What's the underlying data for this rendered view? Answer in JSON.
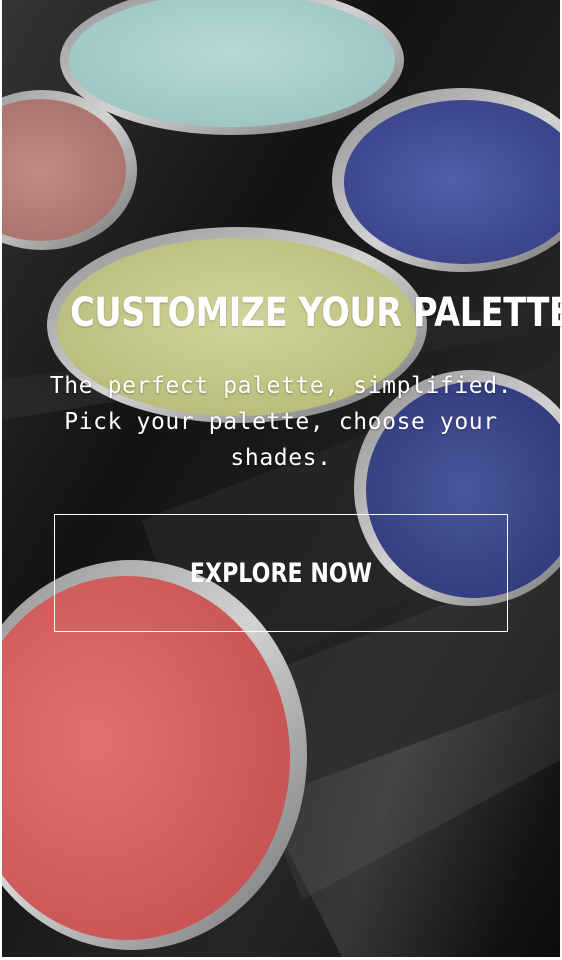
{
  "hero": {
    "image": {
      "description_icon": "eyeshadow-palette-photo",
      "shade_colors": [
        "#b9e2de",
        "#c98a82",
        "#4b58a8",
        "#d9dd9a",
        "#48559c",
        "#ec6c6c"
      ],
      "background_color": "#1a1a1a"
    },
    "headline": "CUSTOMIZE YOUR PALETTE",
    "subtext": "The perfect palette, simplified. Pick your palette, choose your shades.",
    "cta_label": "EXPLORE NOW"
  }
}
